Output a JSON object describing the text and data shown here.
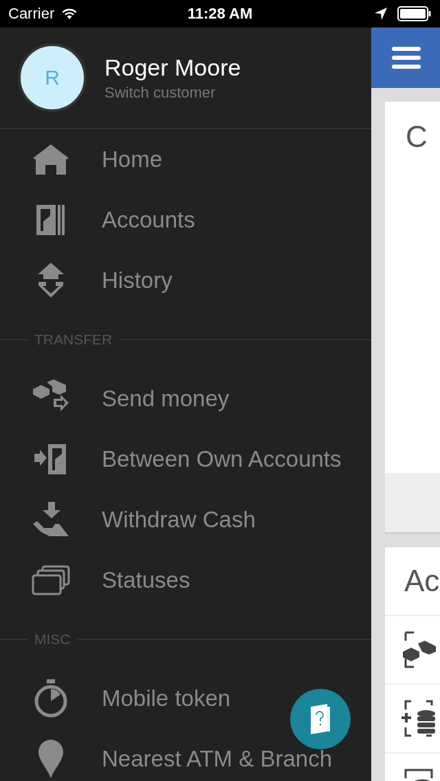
{
  "status_bar": {
    "carrier": "Carrier",
    "time": "11:28 AM"
  },
  "profile": {
    "initial": "R",
    "name": "Roger Moore",
    "subtitle": "Switch customer"
  },
  "menu_sections": [
    {
      "items": [
        {
          "label": "Home"
        },
        {
          "label": "Accounts"
        },
        {
          "label": "History"
        }
      ]
    },
    {
      "title": "TRANSFER",
      "items": [
        {
          "label": "Send money"
        },
        {
          "label": "Between Own Accounts"
        },
        {
          "label": "Withdraw Cash"
        },
        {
          "label": "Statuses"
        }
      ]
    },
    {
      "title": "MISC",
      "items": [
        {
          "label": "Mobile token"
        },
        {
          "label": "Nearest ATM & Branch"
        }
      ]
    }
  ],
  "main": {
    "card_title": "C",
    "list_title": "Ac"
  }
}
